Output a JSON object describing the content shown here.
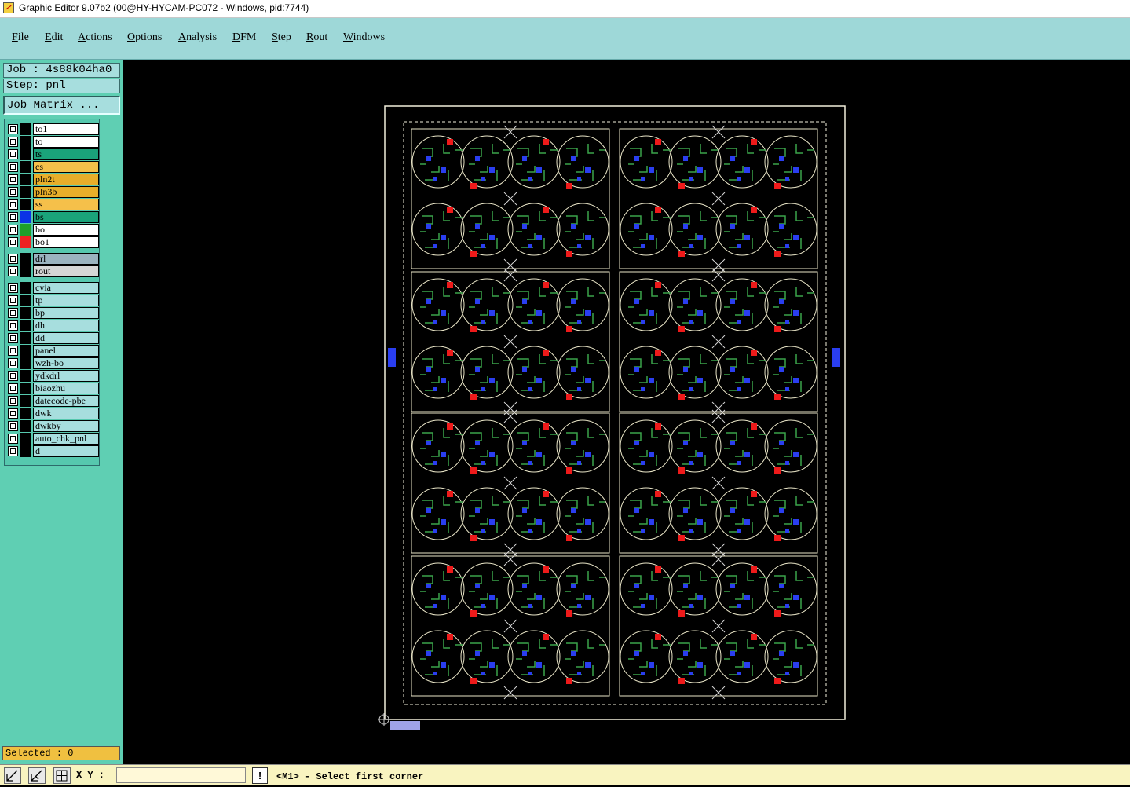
{
  "window": {
    "title": "Graphic Editor 9.07b2 (00@HY-HYCAM-PC072 - Windows, pid:7744)"
  },
  "menu": [
    "File",
    "Edit",
    "Actions",
    "Options",
    "Analysis",
    "DFM",
    "Step",
    "Rout",
    "Windows"
  ],
  "job": {
    "job_line": "Job : 4s88k04ha0",
    "step_line": "Step: pnl",
    "matrix_button": "Job Matrix ..."
  },
  "layers_board": [
    {
      "name": "to1",
      "bg": "#ffffff",
      "swatch": "#000000"
    },
    {
      "name": "to",
      "bg": "#ffffff",
      "swatch": "#000000"
    },
    {
      "name": "ts",
      "bg": "#1aa37a",
      "swatch": "#000000"
    },
    {
      "name": "cs",
      "bg": "#f5c04a",
      "swatch": "#000000"
    },
    {
      "name": "pln2t",
      "bg": "#e8ae2a",
      "swatch": "#000000"
    },
    {
      "name": "pln3b",
      "bg": "#e8ae2a",
      "swatch": "#000000"
    },
    {
      "name": "ss",
      "bg": "#f5c04a",
      "swatch": "#000000"
    },
    {
      "name": "bs",
      "bg": "#1aa37a",
      "swatch": "#0b33e6"
    },
    {
      "name": "bo",
      "bg": "#ffffff",
      "swatch": "#1f9e2a"
    },
    {
      "name": "bo1",
      "bg": "#ffffff",
      "swatch": "#ee2222"
    }
  ],
  "layers_drill": [
    {
      "name": "drl",
      "bg": "#9bb3bf",
      "swatch": "#000000"
    },
    {
      "name": "rout",
      "bg": "#d6d6d6",
      "swatch": "#000000"
    }
  ],
  "layers_misc": [
    {
      "name": "cvia",
      "bg": "#a7dede",
      "swatch": "#000000"
    },
    {
      "name": "tp",
      "bg": "#a7dede",
      "swatch": "#000000"
    },
    {
      "name": "bp",
      "bg": "#a7dede",
      "swatch": "#000000"
    },
    {
      "name": "dh",
      "bg": "#a7dede",
      "swatch": "#000000"
    },
    {
      "name": "dd",
      "bg": "#a7dede",
      "swatch": "#000000"
    },
    {
      "name": "panel",
      "bg": "#a7dede",
      "swatch": "#000000"
    },
    {
      "name": "wzh-bo",
      "bg": "#a7dede",
      "swatch": "#000000"
    },
    {
      "name": "ydkdrl",
      "bg": "#a7dede",
      "swatch": "#000000"
    },
    {
      "name": "biaozhu",
      "bg": "#a7dede",
      "swatch": "#000000"
    },
    {
      "name": "datecode-pbe",
      "bg": "#a7dede",
      "swatch": "#000000"
    },
    {
      "name": "dwk",
      "bg": "#a7dede",
      "swatch": "#000000"
    },
    {
      "name": "dwkby",
      "bg": "#a7dede",
      "swatch": "#000000"
    },
    {
      "name": "auto_chk_pnl",
      "bg": "#a7dede",
      "swatch": "#000000"
    },
    {
      "name": "d",
      "bg": "#a7dede",
      "swatch": "#000000"
    }
  ],
  "selected": "Selected : 0",
  "coords": {
    "label": "X Y :",
    "value": ""
  },
  "status": "<M1> - Select first corner",
  "colors": {
    "panel_outline": "#f2efdc",
    "board_outline": "#eae6c8",
    "copper_green": "#3aa44a",
    "pad_blue": "#2a3ef0",
    "fiducial_red": "#ee1a1a",
    "canvas": "#000000"
  }
}
